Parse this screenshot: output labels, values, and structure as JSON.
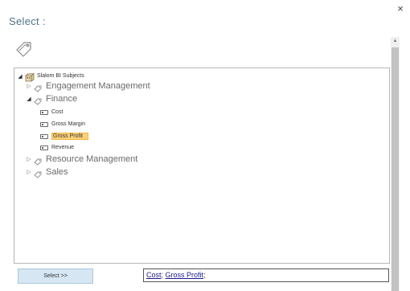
{
  "dialog": {
    "title": "Select :",
    "close_glyph": "×",
    "tag_icon": "tag-icon"
  },
  "tree": {
    "root": {
      "label": "Slalom BI Subjects",
      "icon": "cube-icon",
      "expanded": true
    },
    "items": [
      {
        "label": "Engagement Management",
        "icon": "tag-icon",
        "expanded": false
      },
      {
        "label": "Finance",
        "icon": "tag-icon",
        "expanded": true,
        "children": [
          {
            "label": "Cost",
            "icon": "measure-icon",
            "selected": false
          },
          {
            "label": "Gross Margin",
            "icon": "measure-icon",
            "selected": false
          },
          {
            "label": "Gross Profit",
            "icon": "measure-icon",
            "selected": true
          },
          {
            "label": "Revenue",
            "icon": "measure-icon",
            "selected": false
          }
        ]
      },
      {
        "label": "Resource Management",
        "icon": "tag-icon",
        "expanded": false
      },
      {
        "label": "Sales",
        "icon": "tag-icon",
        "expanded": false
      }
    ],
    "expander_collapsed": "▷",
    "expander_expanded": "◢"
  },
  "actions": {
    "select_label": "Select >>"
  },
  "selection": {
    "items": [
      "Cost",
      "Gross Profit"
    ],
    "separator": ";"
  },
  "colors": {
    "title": "#4e7287",
    "selected_bg": "#fbd27a",
    "button_bg": "#d6e7f3",
    "link": "#1a1a8e"
  }
}
